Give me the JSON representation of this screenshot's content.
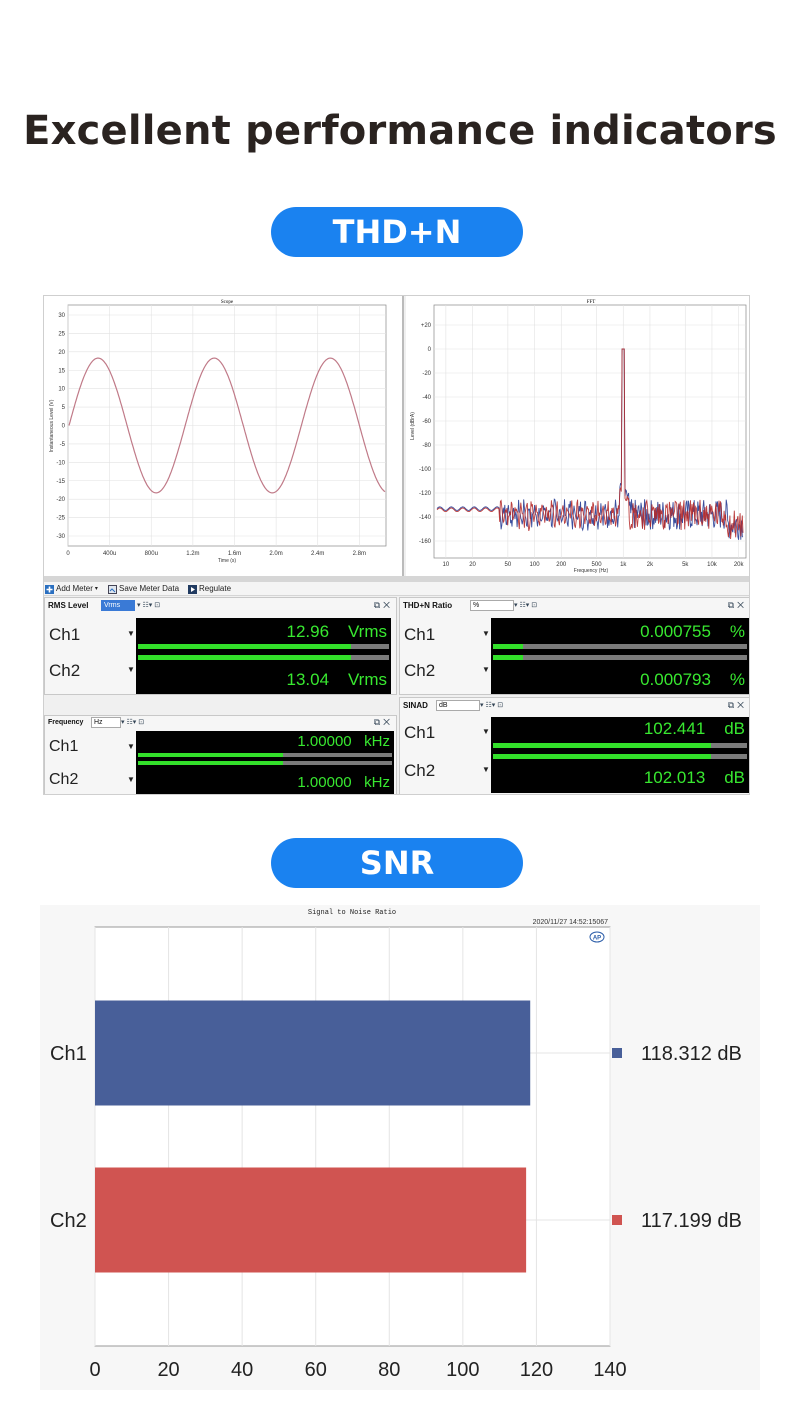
{
  "title": "Excellent performance indicators",
  "sections": {
    "thd_label": "THD+N",
    "snr_label": "SNR"
  },
  "scope": {
    "title": "Scope",
    "ylabel": "Instantaneous Level (V)",
    "xlabel": "Time (s)",
    "yticks": [
      "30",
      "25",
      "20",
      "15",
      "10",
      "5",
      "0",
      "-5",
      "-10",
      "-15",
      "-20",
      "-25",
      "-30"
    ],
    "xticks": [
      "0",
      "400u",
      "800u",
      "1.2m",
      "1.6m",
      "2.0m",
      "2.4m",
      "2.8m"
    ],
    "trace_color": "#c07a88"
  },
  "fft": {
    "title": "FFT",
    "ylabel": "Level (dBrA)",
    "xlabel": "Frequency (Hz)",
    "yticks": [
      "+20",
      "0",
      "-20",
      "-40",
      "-60",
      "-80",
      "-100",
      "-120",
      "-140",
      "-160"
    ],
    "xticks": [
      "10",
      "20",
      "50",
      "100",
      "200",
      "500",
      "1k",
      "2k",
      "5k",
      "10k",
      "20k"
    ],
    "ch1_color": "#3b4f9e",
    "ch2_color": "#b52a2a"
  },
  "toolbar": {
    "add_meter": "Add Meter",
    "save_meter": "Save Meter Data",
    "regulate": "Regulate"
  },
  "meters": {
    "rms": {
      "title": "RMS Level",
      "unit": "Vrms",
      "rows": [
        {
          "label": "Ch1",
          "value": "12.96",
          "unit": "Vrms",
          "fill": 0.85
        },
        {
          "label": "Ch2",
          "value": "13.04",
          "unit": "Vrms",
          "fill": 0.85
        }
      ]
    },
    "thdn": {
      "title": "THD+N Ratio",
      "unit": "%",
      "rows": [
        {
          "label": "Ch1",
          "value": "0.000755",
          "unit": "%",
          "fill": 0.12
        },
        {
          "label": "Ch2",
          "value": "0.000793",
          "unit": "%",
          "fill": 0.12
        }
      ]
    },
    "freq": {
      "title": "Frequency",
      "unit": "Hz",
      "rows": [
        {
          "label": "Ch1",
          "value": "1.00000",
          "unit": "kHz",
          "fill": 0.57
        },
        {
          "label": "Ch2",
          "value": "1.00000",
          "unit": "kHz",
          "fill": 0.57
        }
      ]
    },
    "sinad": {
      "title": "SINAD",
      "unit": "dB",
      "rows": [
        {
          "label": "Ch1",
          "value": "102.441",
          "unit": "dB",
          "fill": 0.86
        },
        {
          "label": "Ch2",
          "value": "102.013",
          "unit": "dB",
          "fill": 0.86
        }
      ]
    }
  },
  "snr_chart": {
    "title": "Signal to Noise Ratio",
    "timestamp": "2020/11/27 14:52:15067",
    "logo": "AP"
  },
  "chart_data": {
    "type": "bar",
    "orientation": "horizontal",
    "title": "Signal to Noise Ratio",
    "categories": [
      "Ch1",
      "Ch2"
    ],
    "values": [
      118.312,
      117.199
    ],
    "value_labels": [
      "118.312  dB",
      "117.199  dB"
    ],
    "colors": [
      "#485f99",
      "#d05451"
    ],
    "xlim": [
      0,
      140
    ],
    "xticks": [
      "0",
      "20",
      "40",
      "60",
      "80",
      "100",
      "120",
      "140"
    ],
    "grid": true
  }
}
